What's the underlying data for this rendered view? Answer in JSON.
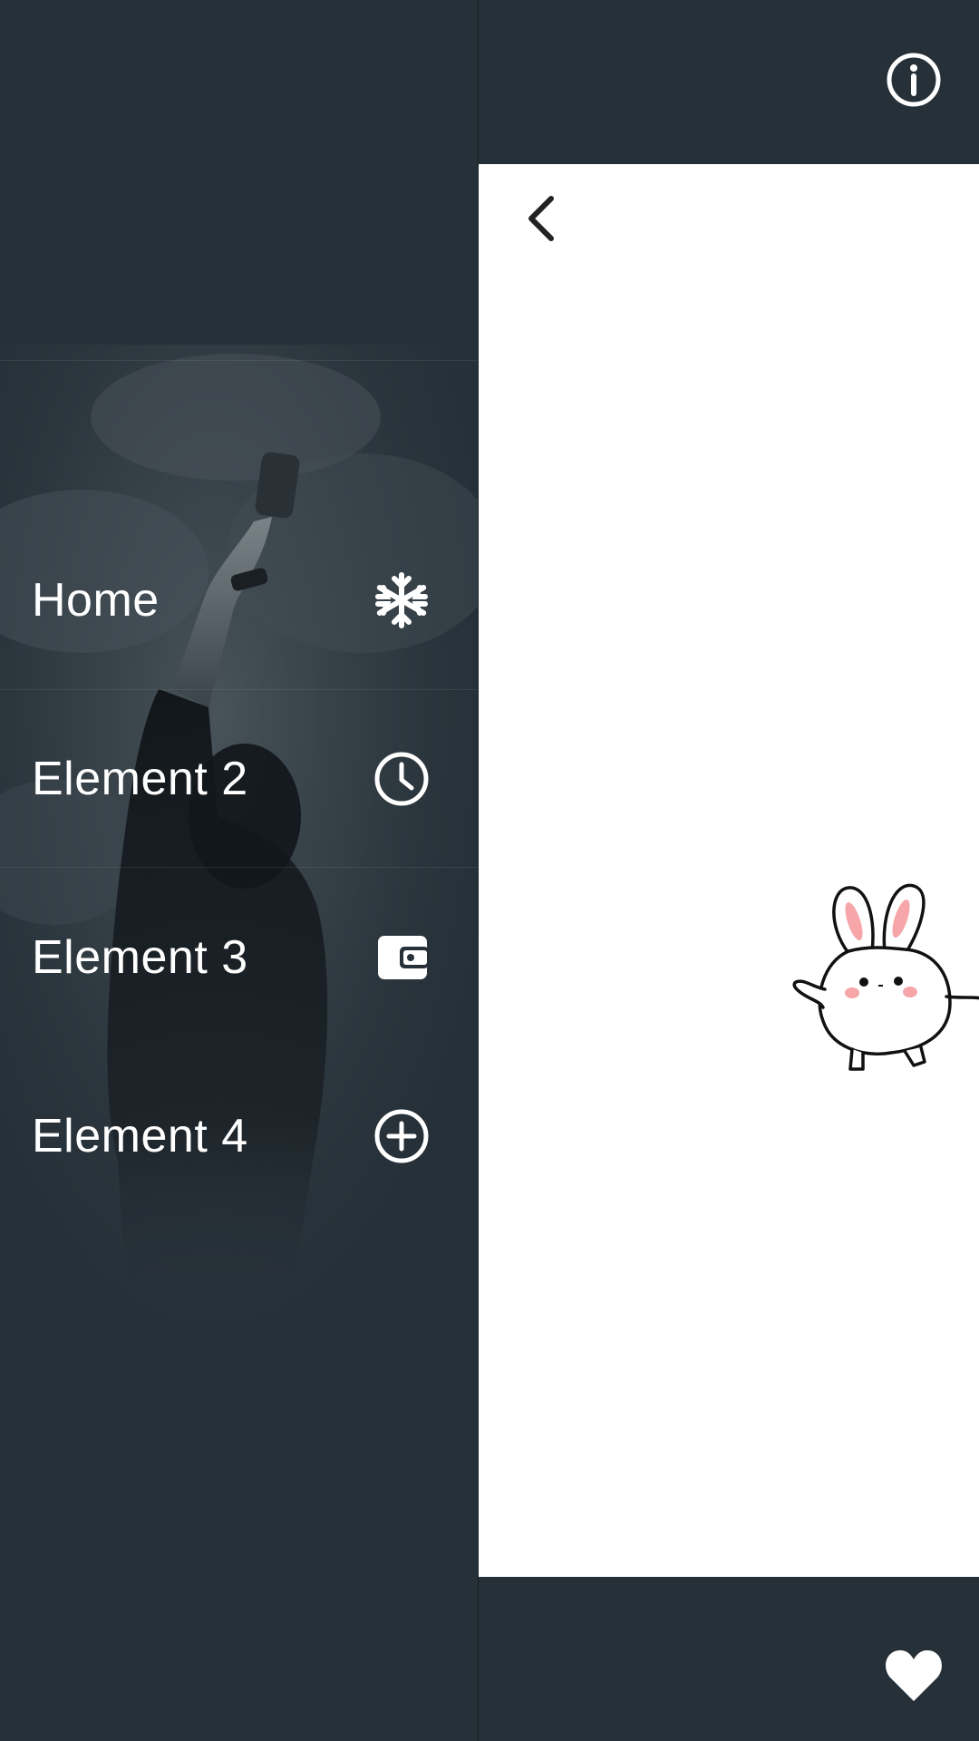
{
  "drawer": {
    "items": [
      {
        "label": "Home",
        "icon": "snowflake-icon"
      },
      {
        "label": "Element 2",
        "icon": "clock-icon"
      },
      {
        "label": "Element 3",
        "icon": "wallet-icon"
      },
      {
        "label": "Element 4",
        "icon": "add-circle-icon"
      }
    ]
  },
  "toolbar": {
    "info_icon": "info-icon",
    "back_icon": "chevron-left-icon",
    "favorite_icon": "heart-icon"
  },
  "colors": {
    "background": "#263038",
    "card": "#ffffff",
    "text": "#ffffff",
    "icon_dark": "#222222",
    "bunny_ear": "#f6a5a8"
  }
}
